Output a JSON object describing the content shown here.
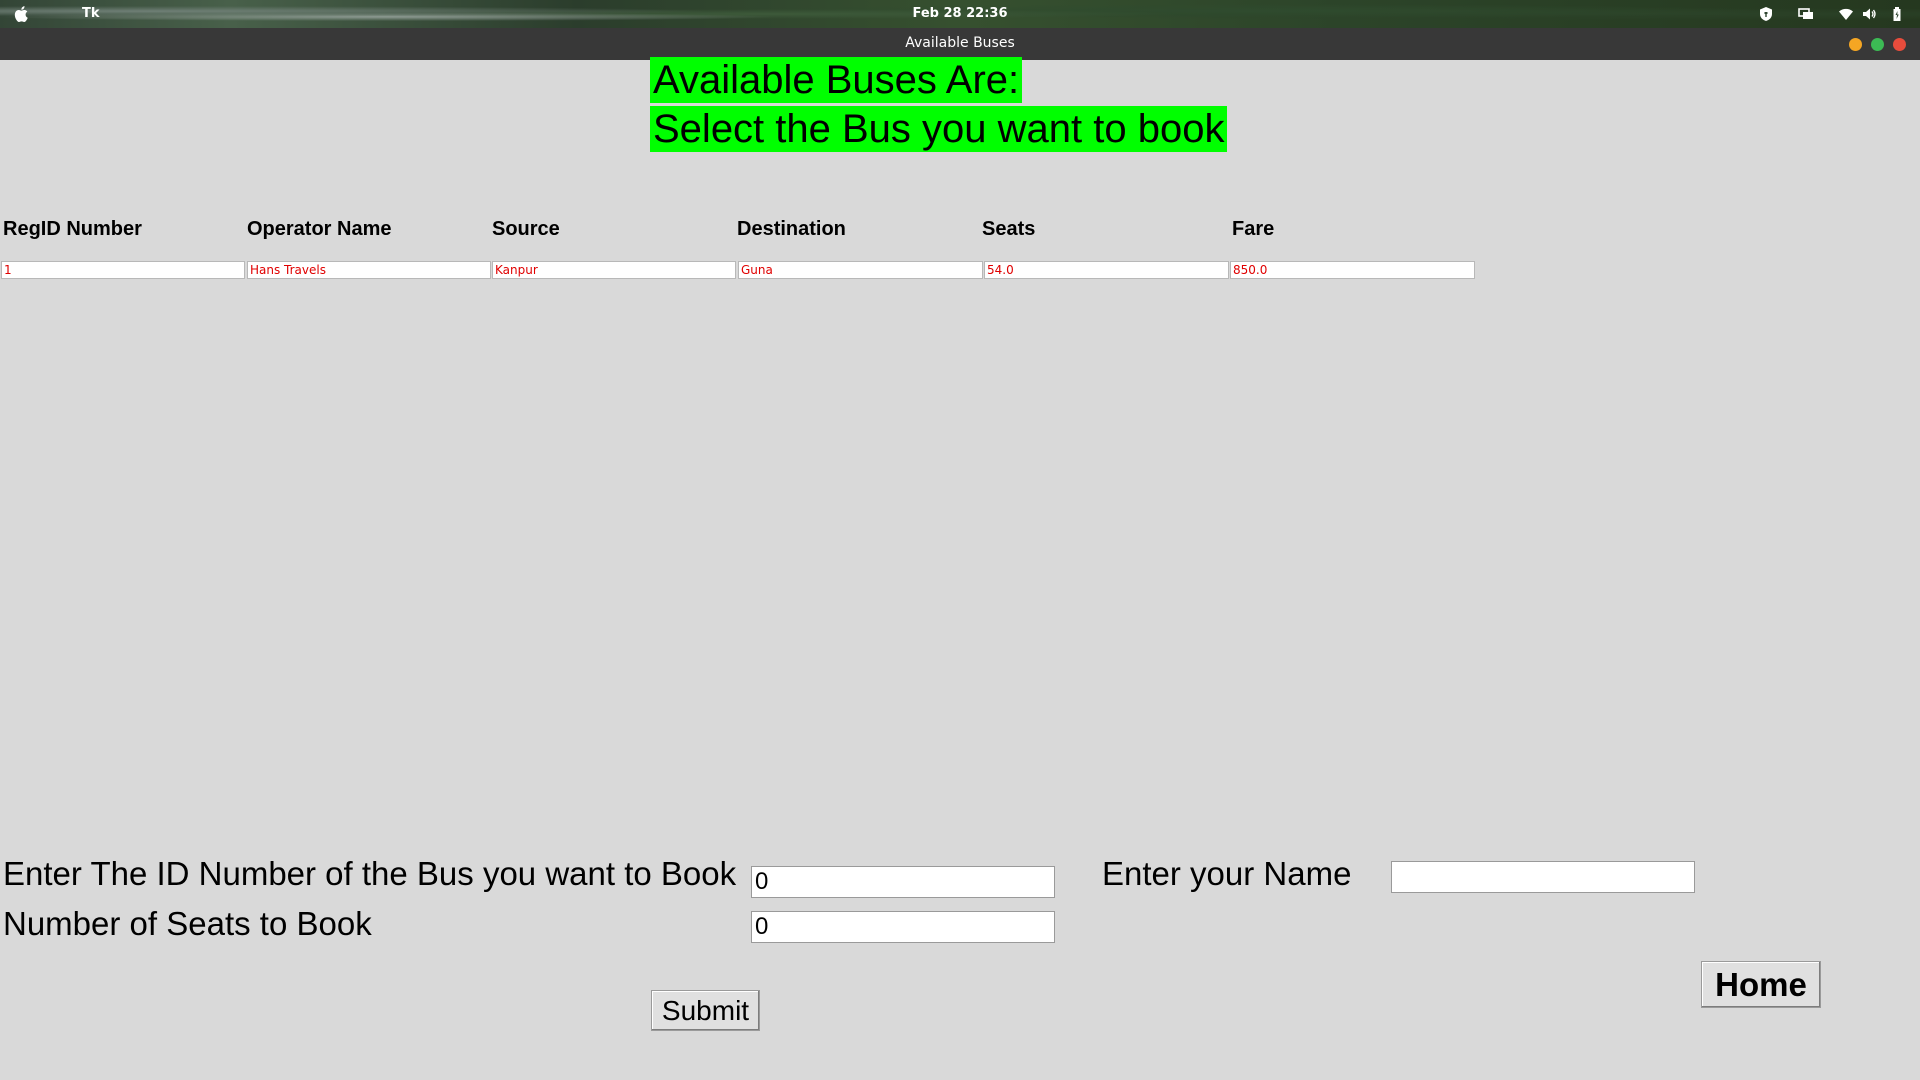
{
  "system_bar": {
    "app_name": "Tk",
    "clock": "Feb 28  22:36",
    "tray_icons": [
      "shield-icon",
      "display-icon",
      "wifi-icon",
      "volume-icon",
      "battery-icon"
    ]
  },
  "window": {
    "title": "Available Buses",
    "controls": [
      "minimize",
      "maximize",
      "close"
    ],
    "control_colors": {
      "minimize": "#f5a623",
      "maximize": "#3cba54",
      "close": "#e74c3c"
    }
  },
  "headings": {
    "line1": "Available Buses Are:",
    "line2": "Select the Bus you want to book",
    "highlight_color": "#00ff00"
  },
  "table": {
    "columns": [
      "RegID Number",
      "Operator Name",
      "Source",
      "Destination",
      "Seats",
      "Fare"
    ],
    "rows": [
      [
        "1",
        "Hans Travels",
        "Kanpur",
        "Guna",
        "54.0",
        "850.0"
      ]
    ],
    "cell_text_color": "#e00000"
  },
  "form": {
    "bus_id_label": "Enter The ID Number of the Bus you want to Book",
    "bus_id_value": "0",
    "seats_label": "Number of Seats to Book",
    "seats_value": "0",
    "name_label": "Enter your Name",
    "name_value": "",
    "submit_label": "Submit",
    "home_label": "Home"
  }
}
